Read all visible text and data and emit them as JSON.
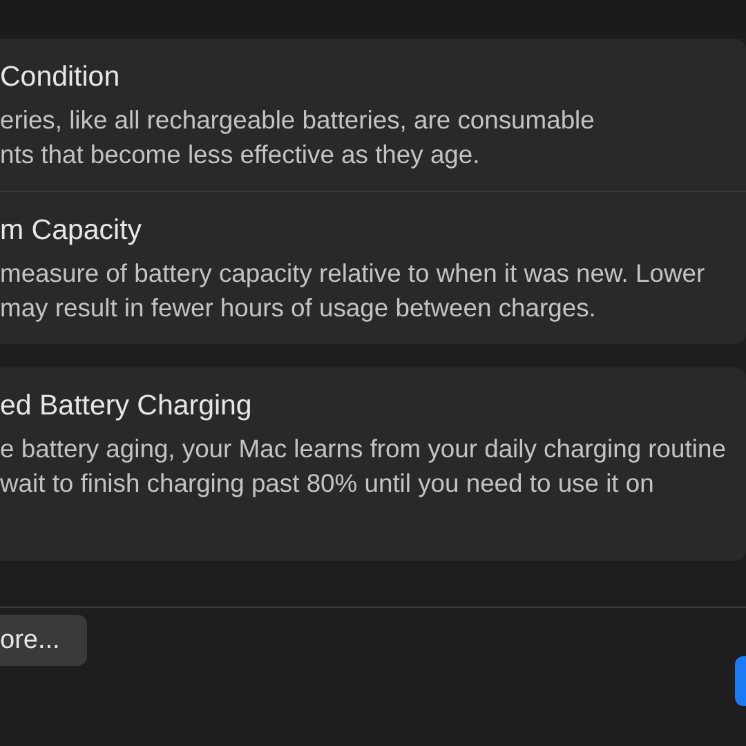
{
  "panels": [
    {
      "rows": [
        {
          "title": "Condition",
          "lines": [
            "eries, like all rechargeable batteries, are consumable",
            "nts that become less effective as they age."
          ]
        },
        {
          "title": "m Capacity",
          "lines": [
            "measure of battery capacity relative to when it was new. Lower",
            "may result in fewer hours of usage between charges."
          ]
        }
      ]
    },
    {
      "rows": [
        {
          "title": "ed Battery Charging",
          "lines": [
            "e battery aging, your Mac learns from your daily charging routine",
            "wait to finish charging past 80% until you need to use it on"
          ]
        }
      ]
    }
  ],
  "buttons": [
    {
      "label": "ore...",
      "kind": "secondary"
    },
    {
      "kind": "primary"
    }
  ]
}
